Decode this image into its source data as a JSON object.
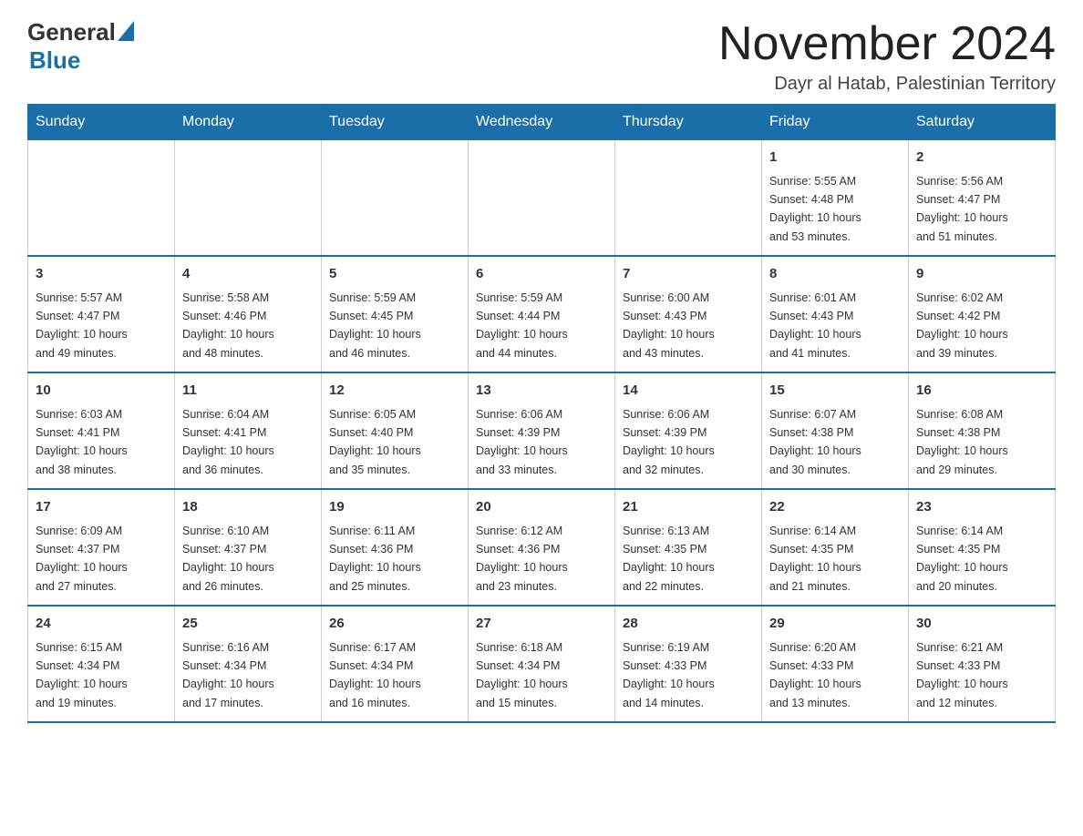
{
  "header": {
    "logo_general": "General",
    "logo_blue": "Blue",
    "title": "November 2024",
    "subtitle": "Dayr al Hatab, Palestinian Territory"
  },
  "weekdays": [
    "Sunday",
    "Monday",
    "Tuesday",
    "Wednesday",
    "Thursday",
    "Friday",
    "Saturday"
  ],
  "weeks": [
    [
      {
        "day": "",
        "info": ""
      },
      {
        "day": "",
        "info": ""
      },
      {
        "day": "",
        "info": ""
      },
      {
        "day": "",
        "info": ""
      },
      {
        "day": "",
        "info": ""
      },
      {
        "day": "1",
        "info": "Sunrise: 5:55 AM\nSunset: 4:48 PM\nDaylight: 10 hours\nand 53 minutes."
      },
      {
        "day": "2",
        "info": "Sunrise: 5:56 AM\nSunset: 4:47 PM\nDaylight: 10 hours\nand 51 minutes."
      }
    ],
    [
      {
        "day": "3",
        "info": "Sunrise: 5:57 AM\nSunset: 4:47 PM\nDaylight: 10 hours\nand 49 minutes."
      },
      {
        "day": "4",
        "info": "Sunrise: 5:58 AM\nSunset: 4:46 PM\nDaylight: 10 hours\nand 48 minutes."
      },
      {
        "day": "5",
        "info": "Sunrise: 5:59 AM\nSunset: 4:45 PM\nDaylight: 10 hours\nand 46 minutes."
      },
      {
        "day": "6",
        "info": "Sunrise: 5:59 AM\nSunset: 4:44 PM\nDaylight: 10 hours\nand 44 minutes."
      },
      {
        "day": "7",
        "info": "Sunrise: 6:00 AM\nSunset: 4:43 PM\nDaylight: 10 hours\nand 43 minutes."
      },
      {
        "day": "8",
        "info": "Sunrise: 6:01 AM\nSunset: 4:43 PM\nDaylight: 10 hours\nand 41 minutes."
      },
      {
        "day": "9",
        "info": "Sunrise: 6:02 AM\nSunset: 4:42 PM\nDaylight: 10 hours\nand 39 minutes."
      }
    ],
    [
      {
        "day": "10",
        "info": "Sunrise: 6:03 AM\nSunset: 4:41 PM\nDaylight: 10 hours\nand 38 minutes."
      },
      {
        "day": "11",
        "info": "Sunrise: 6:04 AM\nSunset: 4:41 PM\nDaylight: 10 hours\nand 36 minutes."
      },
      {
        "day": "12",
        "info": "Sunrise: 6:05 AM\nSunset: 4:40 PM\nDaylight: 10 hours\nand 35 minutes."
      },
      {
        "day": "13",
        "info": "Sunrise: 6:06 AM\nSunset: 4:39 PM\nDaylight: 10 hours\nand 33 minutes."
      },
      {
        "day": "14",
        "info": "Sunrise: 6:06 AM\nSunset: 4:39 PM\nDaylight: 10 hours\nand 32 minutes."
      },
      {
        "day": "15",
        "info": "Sunrise: 6:07 AM\nSunset: 4:38 PM\nDaylight: 10 hours\nand 30 minutes."
      },
      {
        "day": "16",
        "info": "Sunrise: 6:08 AM\nSunset: 4:38 PM\nDaylight: 10 hours\nand 29 minutes."
      }
    ],
    [
      {
        "day": "17",
        "info": "Sunrise: 6:09 AM\nSunset: 4:37 PM\nDaylight: 10 hours\nand 27 minutes."
      },
      {
        "day": "18",
        "info": "Sunrise: 6:10 AM\nSunset: 4:37 PM\nDaylight: 10 hours\nand 26 minutes."
      },
      {
        "day": "19",
        "info": "Sunrise: 6:11 AM\nSunset: 4:36 PM\nDaylight: 10 hours\nand 25 minutes."
      },
      {
        "day": "20",
        "info": "Sunrise: 6:12 AM\nSunset: 4:36 PM\nDaylight: 10 hours\nand 23 minutes."
      },
      {
        "day": "21",
        "info": "Sunrise: 6:13 AM\nSunset: 4:35 PM\nDaylight: 10 hours\nand 22 minutes."
      },
      {
        "day": "22",
        "info": "Sunrise: 6:14 AM\nSunset: 4:35 PM\nDaylight: 10 hours\nand 21 minutes."
      },
      {
        "day": "23",
        "info": "Sunrise: 6:14 AM\nSunset: 4:35 PM\nDaylight: 10 hours\nand 20 minutes."
      }
    ],
    [
      {
        "day": "24",
        "info": "Sunrise: 6:15 AM\nSunset: 4:34 PM\nDaylight: 10 hours\nand 19 minutes."
      },
      {
        "day": "25",
        "info": "Sunrise: 6:16 AM\nSunset: 4:34 PM\nDaylight: 10 hours\nand 17 minutes."
      },
      {
        "day": "26",
        "info": "Sunrise: 6:17 AM\nSunset: 4:34 PM\nDaylight: 10 hours\nand 16 minutes."
      },
      {
        "day": "27",
        "info": "Sunrise: 6:18 AM\nSunset: 4:34 PM\nDaylight: 10 hours\nand 15 minutes."
      },
      {
        "day": "28",
        "info": "Sunrise: 6:19 AM\nSunset: 4:33 PM\nDaylight: 10 hours\nand 14 minutes."
      },
      {
        "day": "29",
        "info": "Sunrise: 6:20 AM\nSunset: 4:33 PM\nDaylight: 10 hours\nand 13 minutes."
      },
      {
        "day": "30",
        "info": "Sunrise: 6:21 AM\nSunset: 4:33 PM\nDaylight: 10 hours\nand 12 minutes."
      }
    ]
  ]
}
